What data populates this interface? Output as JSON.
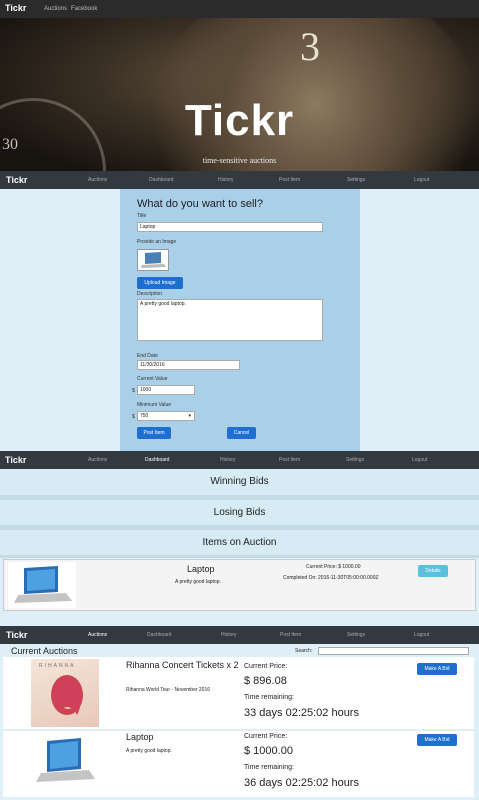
{
  "top_nav": {
    "brand": "Tickr",
    "links": [
      "Auctions",
      "Facebook"
    ]
  },
  "hero": {
    "title": "Tickr",
    "subtitle": "time-sensitive auctions",
    "dial_digit": "3",
    "dial_digit_2": "30"
  },
  "main_nav": {
    "brand": "Tickr",
    "items": [
      "Auctions",
      "Dashboard",
      "History",
      "Post Item",
      "Settings",
      "Logout"
    ]
  },
  "sell_form": {
    "heading": "What do you want to sell?",
    "title_label": "Title",
    "title_value": "Laptop",
    "image_label": "Provide an Image",
    "upload_button": "Upload Image",
    "description_label": "Description",
    "description_value": "A pretty good laptop.",
    "end_date_label": "End Date",
    "end_date_value": "11/30/2016",
    "current_value_label": "Current Value",
    "currency_symbol": "$",
    "current_value": "1000",
    "minimum_value_label": "Minimum Value",
    "minimum_value": "750",
    "post_button": "Post Item",
    "cancel_button": "Cancel"
  },
  "dashboard": {
    "winning_bids": "Winning Bids",
    "losing_bids": "Losing Bids",
    "items_on_auction": "Items on Auction",
    "item": {
      "title": "Laptop",
      "description": "A pretty good laptop.",
      "current_price": "Current Price: $ 1000.00",
      "completed_on": "Completed On: 2016-11-30T05:00:00.000Z",
      "details_button": "Details"
    }
  },
  "auctions": {
    "heading": "Current Auctions",
    "search_label": "Search:",
    "search_value": "",
    "items": [
      {
        "title": "Rihanna Concert Tickets x 2",
        "description": "Rihanna World Tour - November 2016",
        "price_label": "Current Price:",
        "price": "$ 896.08",
        "time_label": "Time remaining:",
        "time": "33 days 02:25:02 hours",
        "bid_button": "Make A Bid",
        "image_caption": "RIHANNA"
      },
      {
        "title": "Laptop",
        "description": "A pretty good laptop.",
        "price_label": "Current Price:",
        "price": "$ 1000.00",
        "time_label": "Time remaining:",
        "time": "36 days 02:25:02 hours",
        "bid_button": "Make A Bid"
      }
    ]
  },
  "colors": {
    "nav_bg": "#333a3f",
    "panel_bg": "#a9cfe9",
    "page_bg": "#dfeff7",
    "primary_button": "#1f6fd1",
    "details_button": "#5bc0de"
  }
}
